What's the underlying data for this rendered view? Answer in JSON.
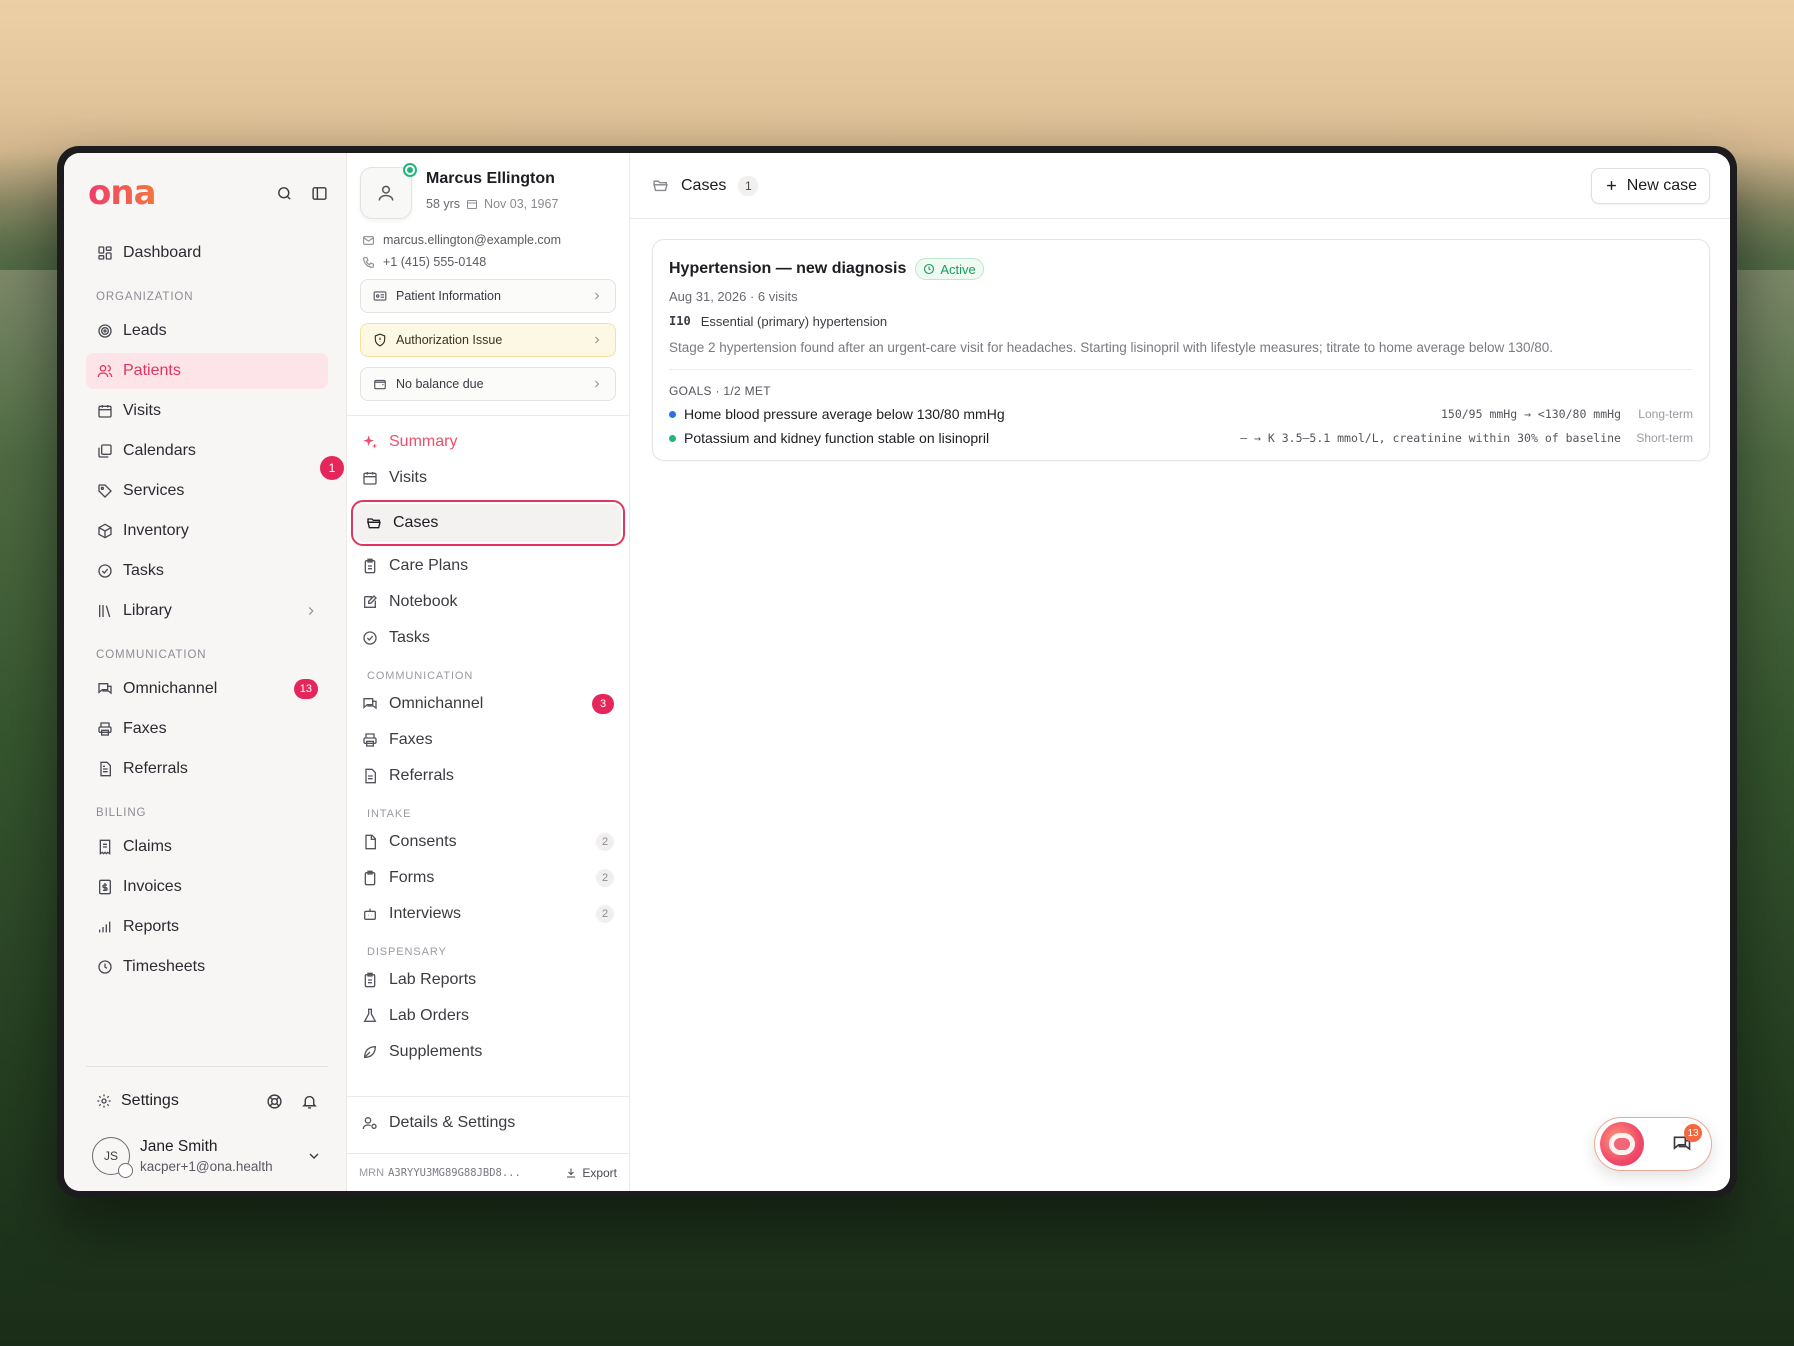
{
  "brand": {
    "logo": "ona"
  },
  "sidebar": {
    "dashboard": "Dashboard",
    "organization_label": "ORGANIZATION",
    "organization": [
      {
        "label": "Leads",
        "icon": "target-icon"
      },
      {
        "label": "Patients",
        "icon": "users-icon",
        "active": true
      },
      {
        "label": "Visits",
        "icon": "calendar-icon"
      },
      {
        "label": "Calendars",
        "icon": "calendars-icon"
      },
      {
        "label": "Services",
        "icon": "tag-icon"
      },
      {
        "label": "Inventory",
        "icon": "box-icon"
      },
      {
        "label": "Tasks",
        "icon": "check-circle-icon"
      },
      {
        "label": "Library",
        "icon": "library-icon"
      }
    ],
    "floating_badge": "1",
    "communication_label": "COMMUNICATION",
    "communication": [
      {
        "label": "Omnichannel",
        "badge": "13"
      },
      {
        "label": "Faxes"
      },
      {
        "label": "Referrals"
      }
    ],
    "billing_label": "BILLING",
    "billing": [
      {
        "label": "Claims"
      },
      {
        "label": "Invoices"
      },
      {
        "label": "Reports"
      },
      {
        "label": "Timesheets"
      }
    ],
    "settings": "Settings",
    "user": {
      "initials": "JS",
      "name": "Jane Smith",
      "email": "kacper+1@ona.health"
    }
  },
  "patient": {
    "name": "Marcus Ellington",
    "age": "58 yrs",
    "dob": "Nov 03, 1967",
    "email": "marcus.ellington@example.com",
    "phone": "+1 (415) 555-0148",
    "buttons": {
      "info": "Patient Information",
      "auth": "Authorization Issue",
      "balance": "No balance due"
    },
    "nav": {
      "summary": "Summary",
      "visits": "Visits",
      "cases": "Cases",
      "care_plans": "Care Plans",
      "notebook": "Notebook",
      "tasks": "Tasks"
    },
    "communication_label": "COMMUNICATION",
    "communication": {
      "omnichannel": "Omnichannel",
      "omnichannel_badge": "3",
      "faxes": "Faxes",
      "referrals": "Referrals"
    },
    "intake_label": "INTAKE",
    "intake": {
      "consents": "Consents",
      "consents_count": "2",
      "forms": "Forms",
      "forms_count": "2",
      "interviews": "Interviews",
      "interviews_count": "2"
    },
    "dispensary_label": "DISPENSARY",
    "dispensary": {
      "lab_reports": "Lab Reports",
      "lab_orders": "Lab Orders",
      "supplements": "Supplements"
    },
    "details": "Details & Settings",
    "mrn_label": "MRN",
    "mrn": "A3RYYU3MG89G88JBD8...",
    "export": "Export"
  },
  "main": {
    "title": "Cases",
    "count": "1",
    "new_case": "New case",
    "case": {
      "title": "Hypertension — new diagnosis",
      "status": "Active",
      "meta": "Aug 31, 2026 · 6 visits",
      "code": "I10",
      "code_desc": "Essential (primary) hypertension",
      "description": "Stage 2 hypertension found after an urgent-care visit for headaches. Starting lisinopril with lifestyle measures; titrate to home average below 130/80.",
      "goals_label": "GOALS · 1/2 MET",
      "goals": [
        {
          "text": "Home blood pressure average below 130/80 mmHg",
          "target": "150/95 mmHg → <130/80 mmHg",
          "term": "Long-term",
          "color": "#2f6fe8"
        },
        {
          "text": "Potassium and kidney function stable on lisinopril",
          "target": "— → K 3.5–5.1 mmol/L, creatinine within 30% of baseline",
          "term": "Short-term",
          "color": "#22b57a"
        }
      ]
    },
    "chat_badge": "13"
  },
  "colors": {
    "accent": "#e0355e",
    "active_bg": "#fde4e8",
    "success": "#1c9a5c",
    "badge": "#e5265a"
  }
}
